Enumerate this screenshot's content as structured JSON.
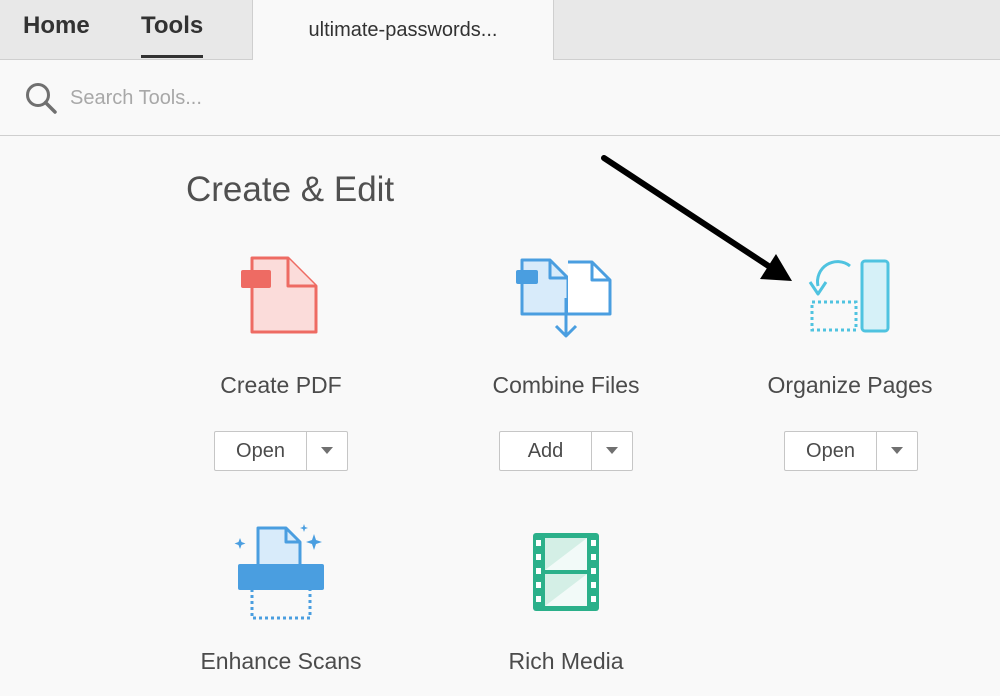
{
  "topbar": {
    "home_label": "Home",
    "tools_label": "Tools",
    "document_tab": "ultimate-passwords..."
  },
  "search": {
    "placeholder": "Search Tools..."
  },
  "section": {
    "title": "Create & Edit"
  },
  "tools": [
    {
      "name": "Create PDF",
      "button": "Open",
      "icon": "create-pdf-icon",
      "color": "#ee6b63"
    },
    {
      "name": "Combine Files",
      "button": "Add",
      "icon": "combine-files-icon",
      "color": "#4a9ee0"
    },
    {
      "name": "Organize Pages",
      "button": "Open",
      "icon": "organize-pages-icon",
      "color": "#4fc3e0"
    },
    {
      "name": "Enhance Scans",
      "icon": "enhance-scans-icon",
      "color": "#4a9ee0"
    },
    {
      "name": "Rich Media",
      "icon": "rich-media-icon",
      "color": "#2bb08a"
    }
  ],
  "annotation": {
    "icon": "pointer-arrow",
    "color": "#000000"
  }
}
